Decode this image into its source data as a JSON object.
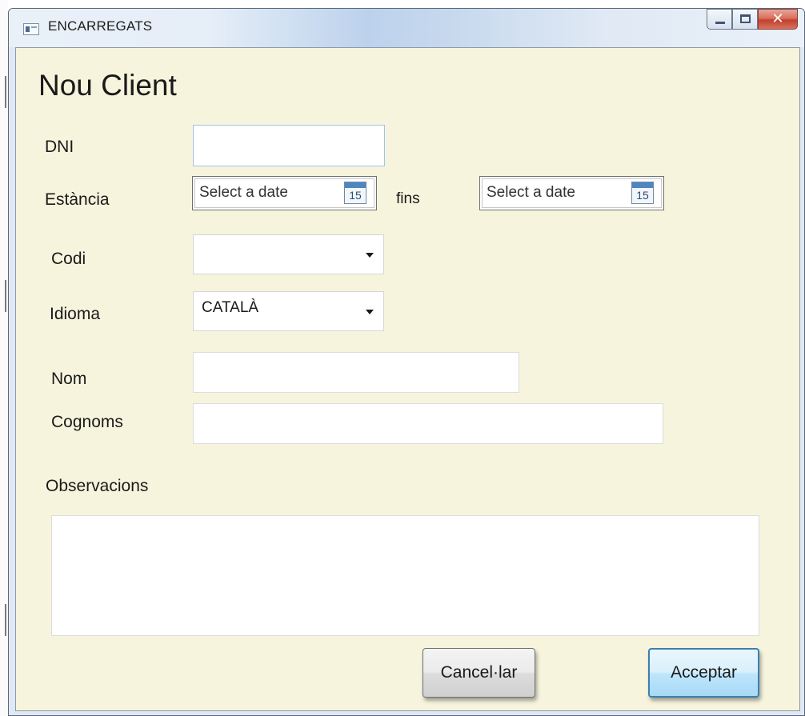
{
  "window": {
    "title": "ENCARREGATS"
  },
  "form": {
    "heading": "Nou Client",
    "dni_label": "DNI",
    "dni_value": "",
    "estancia_label": "Estància",
    "date_from_placeholder": "Select a date",
    "fins_label": "fins",
    "date_to_placeholder": "Select a date",
    "calendar_icon_number": "15",
    "codi_label": "Codi",
    "codi_value": "",
    "idioma_label": "Idioma",
    "idioma_value": "CATALÀ",
    "nom_label": "Nom",
    "nom_value": "",
    "cognoms_label": "Cognoms",
    "cognoms_value": "",
    "observacions_label": "Observacions",
    "observacions_value": ""
  },
  "buttons": {
    "cancel_label": "Cancel·lar",
    "accept_label": "Acceptar"
  },
  "icons": {
    "app": "window-app-icon",
    "minimize": "minimize-icon",
    "maximize": "maximize-icon",
    "close": "close-icon",
    "calendar": "calendar-icon",
    "dropdown": "chevron-down-icon"
  }
}
